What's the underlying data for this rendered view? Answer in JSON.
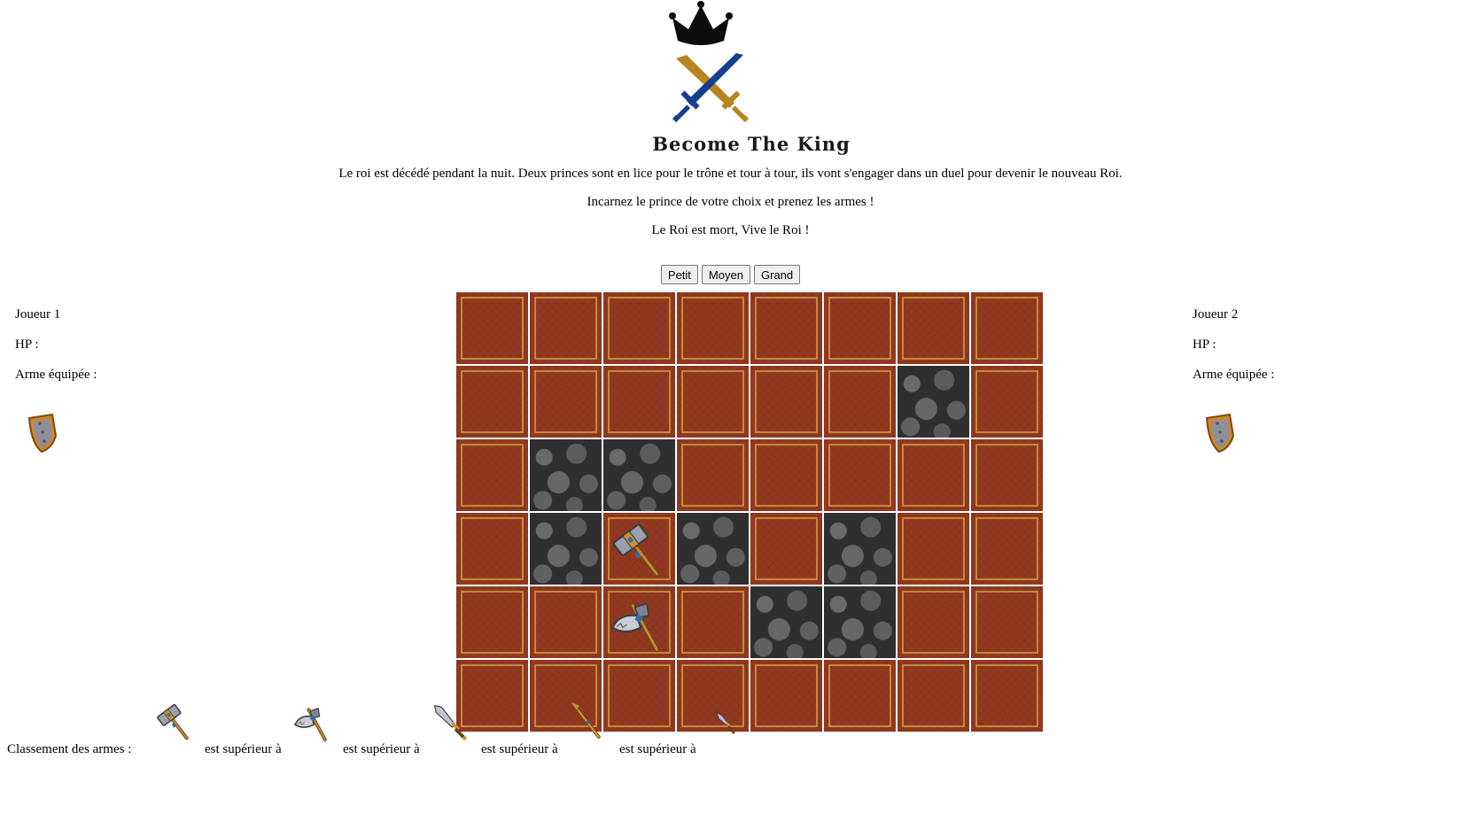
{
  "header": {
    "logo_title": "Become The King",
    "intro_lines": [
      "Le roi est décédé pendant la nuit. Deux princes sont en lice pour le trône et tour à tour, ils vont s'engager dans un duel pour devenir le nouveau Roi.",
      "Incarnez le prince de votre choix et prenez les armes !",
      "Le Roi est mort, Vive le Roi !"
    ]
  },
  "size_buttons": [
    "Petit",
    "Moyen",
    "Grand"
  ],
  "player1": {
    "name": "Joueur 1",
    "hp_label": "HP :",
    "weapon_label": "Arme équipée :",
    "weapon_icon": "shield-icon"
  },
  "player2": {
    "name": "Joueur 2",
    "hp_label": "HP :",
    "weapon_label": "Arme équipée :",
    "weapon_icon": "shield-icon"
  },
  "board": {
    "rows": 6,
    "cols": 8,
    "cells": [
      [
        "carpet",
        "carpet",
        "carpet",
        "carpet",
        "carpet",
        "carpet",
        "carpet",
        "carpet"
      ],
      [
        "carpet",
        "carpet",
        "carpet",
        "carpet",
        "carpet",
        "carpet",
        "rock",
        "carpet"
      ],
      [
        "carpet",
        "rock",
        "rock",
        "carpet",
        "carpet",
        "carpet",
        "carpet",
        "carpet"
      ],
      [
        "carpet",
        "rock",
        "carpet:hammer",
        "rock",
        "carpet",
        "rock",
        "carpet",
        "carpet"
      ],
      [
        "carpet",
        "carpet",
        "carpet:axe",
        "carpet",
        "rock",
        "rock",
        "carpet",
        "carpet"
      ],
      [
        "carpet",
        "carpet",
        "carpet",
        "carpet",
        "carpet",
        "carpet",
        "carpet",
        "carpet"
      ]
    ]
  },
  "ranking": {
    "label": "Classement des armes :",
    "separator": "est supérieur à",
    "weapons": [
      "hammer-icon",
      "axe-icon",
      "sword-icon",
      "spear-icon",
      "dagger-icon"
    ]
  },
  "colors": {
    "carpet": "#923820",
    "carpet_border": "#c58a39",
    "rock": "#4a4a4a",
    "sword_blue": "#13408f",
    "sword_gold": "#b8841f"
  }
}
